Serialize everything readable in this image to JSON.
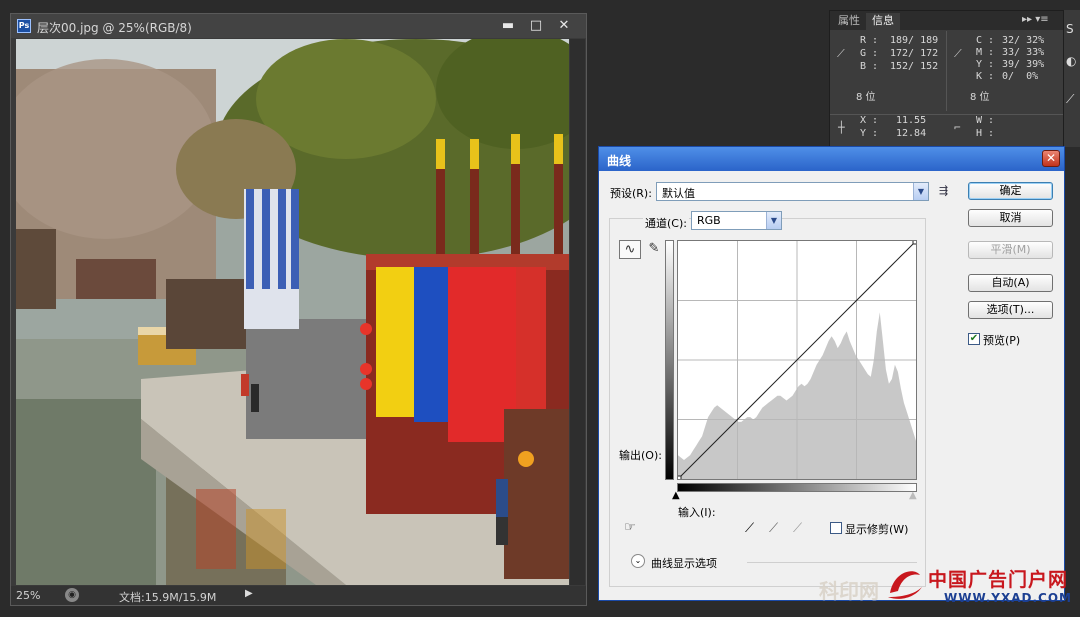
{
  "document": {
    "app_badge": "Ps",
    "title": "层次00.jpg @ 25%(RGB/8)",
    "window_buttons": [
      "▬",
      "□",
      "✕"
    ],
    "status": {
      "zoom": "25%",
      "doc_size": "文档:15.9M/15.9M"
    }
  },
  "info_panel": {
    "tabs": [
      "属性",
      "信息"
    ],
    "menu_icon": "▸▸ ▾≡",
    "rgb": {
      "R": "189/ 189",
      "G": "172/ 172",
      "B": "152/ 152",
      "bit": "8 位"
    },
    "cmyk": {
      "C": "32/ 32%",
      "M": "33/ 33%",
      "Y": "39/ 39%",
      "K": "0/  0%",
      "bit": "8 位"
    },
    "xy": {
      "X": "11.55",
      "Y": "12.84"
    },
    "wh": {
      "W": "",
      "H": ""
    }
  },
  "curves_dialog": {
    "title": "曲线",
    "close": "✕",
    "preset_label": "预设(R):",
    "preset_value": "默认值",
    "preset_menu_icon": "⇶",
    "channel_label": "通道(C):",
    "channel_value": "RGB",
    "output_label": "输出(O):",
    "input_label": "输入(I):",
    "show_clipping_label": "显示修剪(W)",
    "show_clipping_checked": false,
    "curve_options_label": "曲线显示选项",
    "buttons": {
      "ok": "确定",
      "cancel": "取消",
      "smooth": "平滑(M)",
      "auto": "自动(A)",
      "options": "选项(T)..."
    },
    "preview_label": "预览(P)",
    "preview_checked": true,
    "curve_points": [
      [
        0,
        0
      ],
      [
        255,
        255
      ]
    ],
    "histogram": [
      10,
      9,
      8,
      9,
      10,
      12,
      14,
      16,
      18,
      22,
      26,
      28,
      30,
      31,
      30,
      29,
      28,
      27,
      26,
      25,
      24,
      24,
      25,
      26,
      26,
      25,
      26,
      28,
      30,
      31,
      32,
      33,
      34,
      35,
      35,
      34,
      33,
      34,
      35,
      37,
      39,
      40,
      39,
      40,
      42,
      45,
      48,
      50,
      52,
      55,
      58,
      60,
      58,
      55,
      57,
      60,
      62,
      58,
      55,
      52,
      50,
      48,
      46,
      44,
      43,
      50,
      62,
      70,
      58,
      46,
      40,
      42,
      48,
      45,
      38,
      32,
      28,
      24,
      20,
      16
    ]
  },
  "watermark": {
    "left_text": "科印网",
    "name": "中国广告门户网",
    "url": "WWW.YXAD.COM"
  },
  "colors": {
    "dialog_title": "#2b64c9",
    "close_button": "#c2331c",
    "histogram": "#c8c8c8",
    "watermark_red": "#c8171d",
    "watermark_blue": "#1c3f92"
  }
}
